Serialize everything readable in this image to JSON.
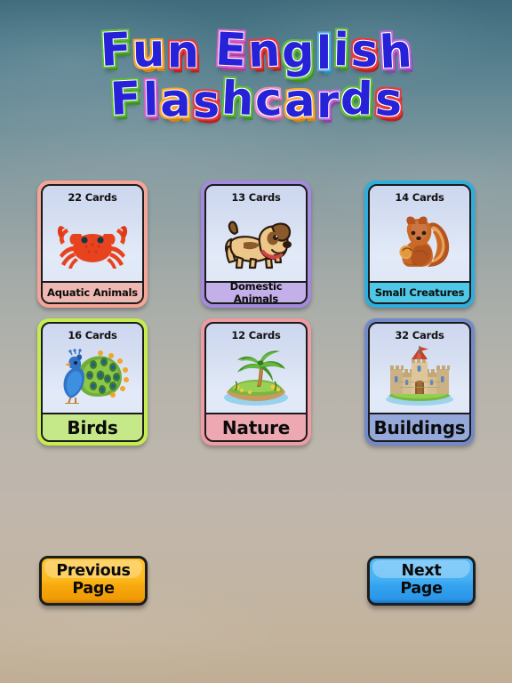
{
  "app": {
    "title_line_1": "Fun English",
    "title_line_2": "Flashcards",
    "title_letters_1": [
      {
        "ch": "F",
        "color": "green"
      },
      {
        "ch": "u",
        "color": "orange"
      },
      {
        "ch": "n",
        "color": "red"
      },
      {
        "ch": " ",
        "color": "none"
      },
      {
        "ch": "E",
        "color": "magenta"
      },
      {
        "ch": "n",
        "color": "red"
      },
      {
        "ch": "g",
        "color": "green"
      },
      {
        "ch": "l",
        "color": "blue"
      },
      {
        "ch": "i",
        "color": "green"
      },
      {
        "ch": "s",
        "color": "red"
      },
      {
        "ch": "h",
        "color": "purple"
      }
    ],
    "title_letters_2": [
      {
        "ch": "F",
        "color": "green"
      },
      {
        "ch": "l",
        "color": "magenta"
      },
      {
        "ch": "a",
        "color": "orange"
      },
      {
        "ch": "s",
        "color": "red"
      },
      {
        "ch": "h",
        "color": "green"
      },
      {
        "ch": "c",
        "color": "pink"
      },
      {
        "ch": "a",
        "color": "orange"
      },
      {
        "ch": "r",
        "color": "purple"
      },
      {
        "ch": "d",
        "color": "green"
      },
      {
        "ch": "s",
        "color": "red"
      }
    ],
    "title_fill_color": "#2722d8",
    "background_top_color": "#3f6b7c",
    "background_bottom_color": "#c0ae95"
  },
  "categories": [
    {
      "count_label": "22 Cards",
      "count": 22,
      "name": "Aquatic Animals",
      "icon": "crab-icon",
      "border_color": "#f4a598",
      "footer_color": "#efb9b3",
      "label_size": "small"
    },
    {
      "count_label": "13 Cards",
      "count": 13,
      "name": "Domestic Animals",
      "icon": "dog-icon",
      "border_color": "#a38ade",
      "footer_color": "#c3b0e8",
      "label_size": "small"
    },
    {
      "count_label": "14 Cards",
      "count": 14,
      "name": "Small Creatures",
      "icon": "squirrel-icon",
      "border_color": "#2eaedd",
      "footer_color": "#4fc8e8",
      "label_size": "small"
    },
    {
      "count_label": "16 Cards",
      "count": 16,
      "name": "Birds",
      "icon": "peacock-icon",
      "border_color": "#c5ed4f",
      "footer_color": "#c5e888",
      "label_size": "big"
    },
    {
      "count_label": "12 Cards",
      "count": 12,
      "name": "Nature",
      "icon": "palm-island-icon",
      "border_color": "#ef9ba3",
      "footer_color": "#eda8b2",
      "label_size": "big"
    },
    {
      "count_label": "32 Cards",
      "count": 32,
      "name": "Buildings",
      "icon": "castle-icon",
      "border_color": "#7389c8",
      "footer_color": "#95a8da",
      "label_size": "big"
    }
  ],
  "navigation": {
    "previous": {
      "line1": "Previous",
      "line2": "Page",
      "color": "#fcbb21"
    },
    "next": {
      "line1": "Next",
      "line2": "Page",
      "color": "#47b1f4"
    }
  }
}
